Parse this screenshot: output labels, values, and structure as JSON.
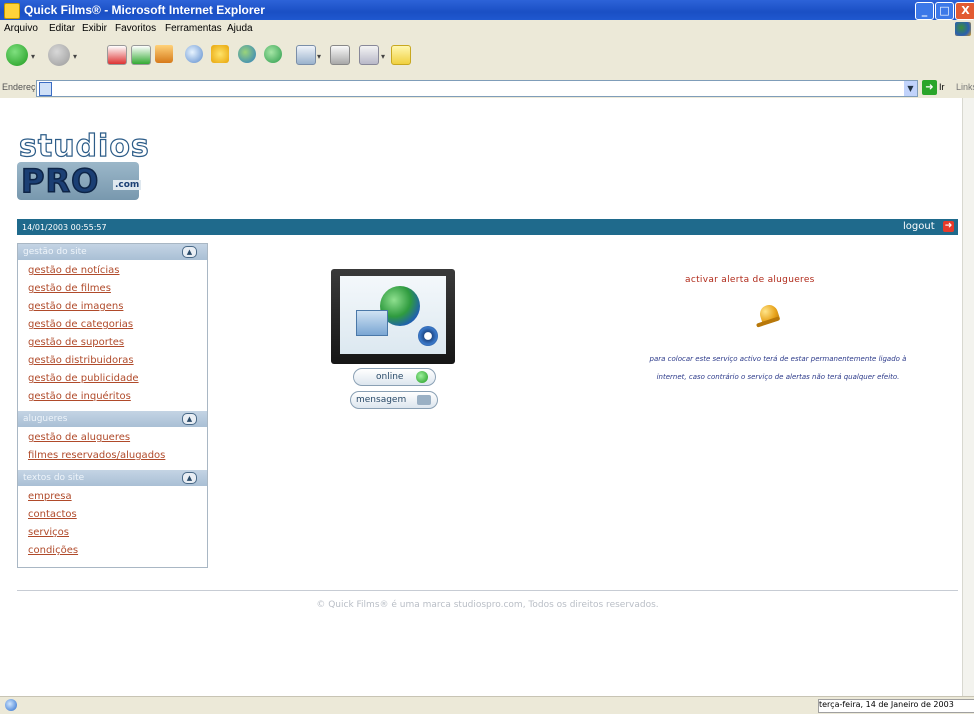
{
  "window": {
    "title": "Quick Films® - Microsoft Internet Explorer",
    "controls": {
      "minimize": "_",
      "maximize": "□",
      "close": "X"
    }
  },
  "menubar": [
    "Arquivo",
    "Editar",
    "Exibir",
    "Favoritos",
    "Ferramentas",
    "Ajuda"
  ],
  "toolbar": {
    "icons": [
      "back-icon",
      "forward-icon",
      "stop-icon",
      "refresh-icon",
      "home-icon",
      "search-icon",
      "favorites-icon",
      "media-icon",
      "history-icon",
      "mail-icon",
      "print-icon",
      "edit-icon",
      "messenger-icon"
    ]
  },
  "addressbar": {
    "label": "Endereço",
    "value": "",
    "go_label": "Ir",
    "links_label": "Links"
  },
  "logo": {
    "line1": "studios",
    "line2": "PRO",
    "suffix": ".com"
  },
  "strip": {
    "datetime": "14/01/2003 00:55:57",
    "logout_label": "logout"
  },
  "sidemenu": {
    "sections": [
      {
        "title": "gestão do site",
        "items": [
          "gestão de notícias",
          "gestão de filmes",
          "gestão de imagens",
          "gestão de categorias",
          "gestão de suportes",
          "gestão distribuidoras",
          "gestão de publicidade",
          "gestão de inquéritos"
        ]
      },
      {
        "title": "alugueres",
        "items": [
          "gestão de alugueres",
          "filmes reservados/alugados"
        ]
      },
      {
        "title": "textos do site",
        "items": [
          "empresa",
          "contactos",
          "serviços",
          "condições"
        ]
      }
    ]
  },
  "center": {
    "online_label": "online",
    "message_label": "mensagem"
  },
  "alert": {
    "title": "activar alerta de alugueres",
    "notice_line1": "para colocar este serviço activo terá de estar permanentemente ligado à",
    "notice_line2": "internet, caso contrário o serviço de alertas não terá qualquer efeito."
  },
  "footer": {
    "text": "© Quick Films® é uma marca studiospro.com, Todos os direitos reservados."
  },
  "statusbar": {
    "clock": "terça-feira, 14 de Janeiro de 2003"
  },
  "colors": {
    "strip": "#1f6a8c",
    "menu_link": "#b04a2a",
    "section_header": "#a9bfd5",
    "alert_title": "#b02a1a",
    "notice": "#2c3a8a"
  }
}
